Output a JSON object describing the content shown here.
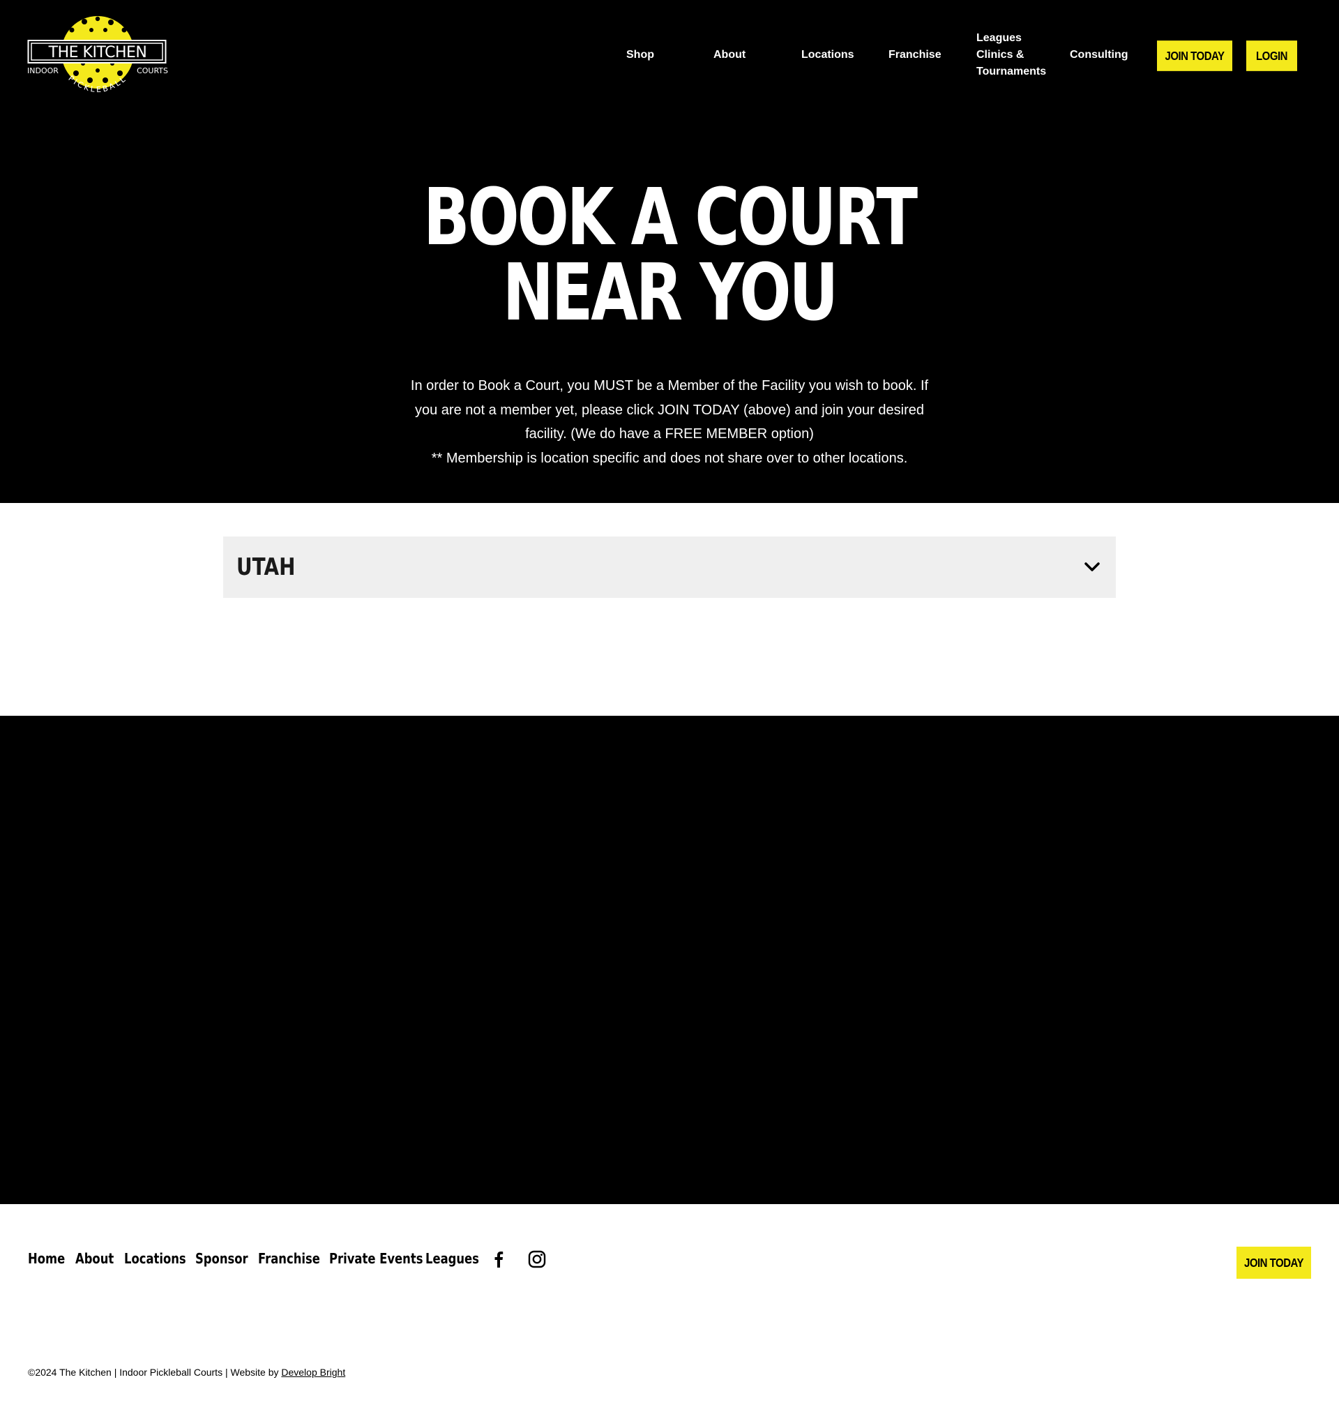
{
  "header": {
    "logo": {
      "title": "THE KITCHEN",
      "left_text": "INDOOR",
      "right_text": "COURTS",
      "arc_text": "PICKLEBALL"
    },
    "nav": {
      "shop": "Shop",
      "about": "About",
      "locations": "Locations",
      "franchise": "Franchise",
      "leagues_line1": "Leagues",
      "leagues_line2": "Clinics &",
      "leagues_line3": "Tournaments",
      "consulting": "Consulting"
    },
    "join_button": "JOIN TODAY",
    "login_button": "LOGIN"
  },
  "hero": {
    "title_line1": "BOOK A COURT",
    "title_line2": "NEAR YOU",
    "text_line1": "In order to Book a Court, you MUST be a Member of the Facility you wish to book. If",
    "text_line2": "you are not a member yet, please click JOIN TODAY (above) and join your desired",
    "text_line3": "facility. (We do have a FREE MEMBER option)",
    "text_line4": "** Membership is location specific and does not share over to other locations."
  },
  "accordion": {
    "label": "UTAH"
  },
  "footer": {
    "links": {
      "home": "Home",
      "about": "About",
      "locations": "Locations",
      "sponsor": "Sponsor",
      "franchise": "Franchise",
      "private_events": "Private Events",
      "leagues": "Leagues"
    },
    "join_button": "JOIN TODAY",
    "copyright_text": "©2024 The Kitchen | Indoor Pickleball Courts | Website by ",
    "credit_link": "Develop Bright"
  },
  "icons": {
    "chevron": "chevron-down-icon",
    "facebook": "facebook-icon",
    "instagram": "instagram-icon"
  },
  "colors": {
    "accent_yellow": "#f4e91c",
    "header_bg": "#000000",
    "accordion_bg": "#efefef"
  }
}
